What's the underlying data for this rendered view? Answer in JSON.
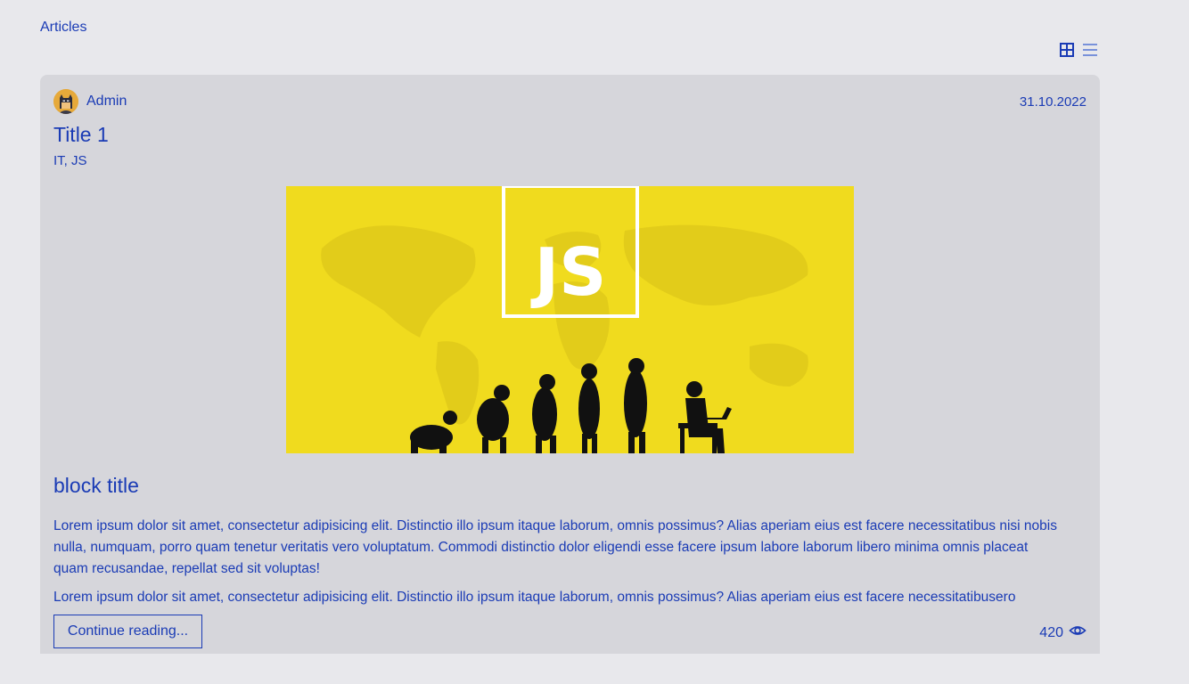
{
  "page": {
    "breadcrumb": "Articles"
  },
  "view_toggles": {
    "grid_icon": "grid-icon",
    "list_icon": "list-icon",
    "accent": "#1a3bb5",
    "muted": "#5b7bd6"
  },
  "article": {
    "author": "Admin",
    "date": "31.10.2022",
    "title": "Title 1",
    "tags": [
      "IT",
      "JS"
    ],
    "tag_separator": ", ",
    "cover_label": "JS",
    "block_title": "block title",
    "paragraphs": [
      "Lorem ipsum dolor sit amet, consectetur adipisicing elit. Distinctio illo ipsum itaque laborum, omnis possimus? Alias aperiam eius est facere necessitatibus nisi nobis nulla, numquam, porro quam tenetur veritatis vero voluptatum. Commodi distinctio dolor eligendi esse facere ipsum labore laborum libero minima omnis placeat quam recusandae, repellat sed sit voluptas!",
      "Lorem ipsum dolor sit amet, consectetur adipisicing elit. Distinctio illo ipsum itaque laborum, omnis possimus? Alias aperiam eius est facere necessitatibusero"
    ],
    "continue_label": "Continue reading...",
    "views": "420",
    "views_icon": "eye-icon"
  },
  "colors": {
    "background": "#e8e8ec",
    "card": "#d6d6db",
    "text": "#1a3bb5",
    "cover": "#f0db1e"
  }
}
